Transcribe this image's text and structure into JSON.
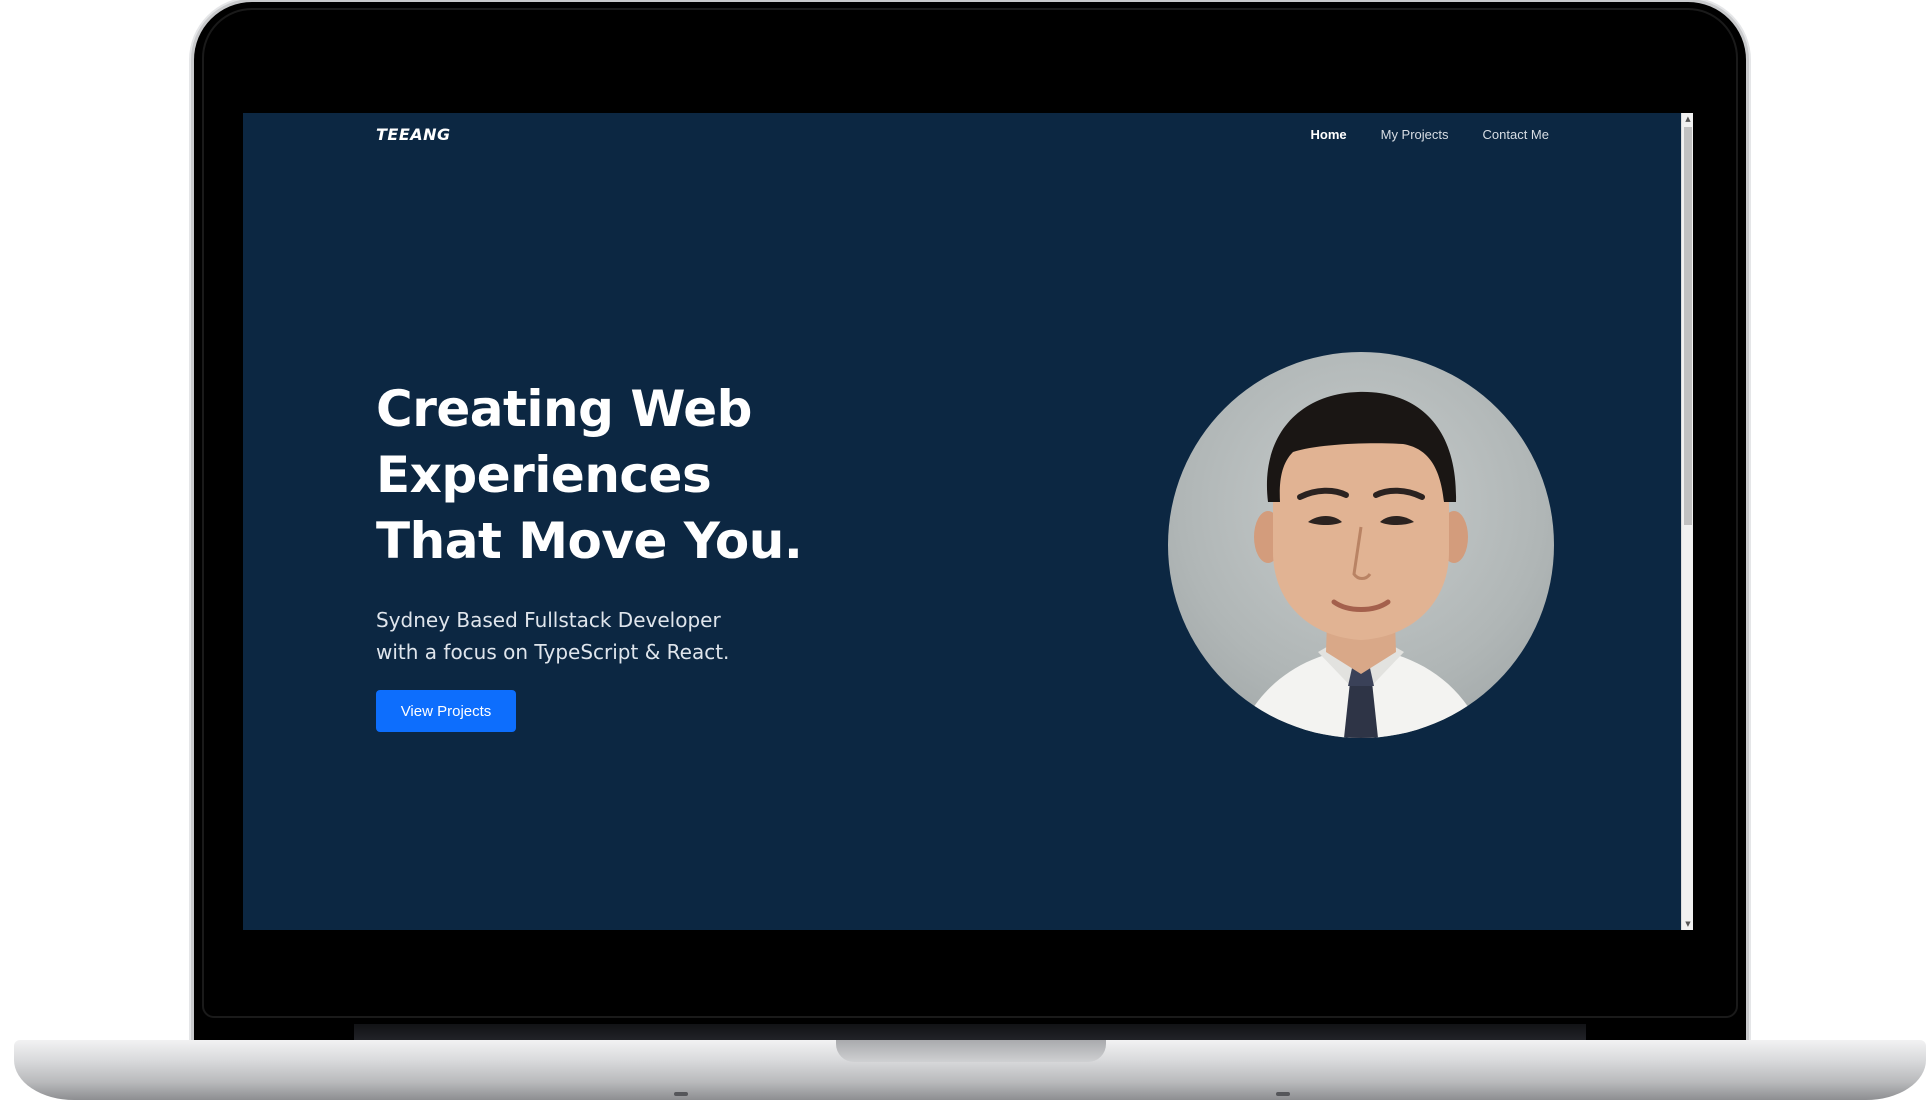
{
  "site": {
    "brand": "TEEANG"
  },
  "nav": {
    "items": [
      {
        "label": "Home",
        "active": true
      },
      {
        "label": "My Projects",
        "active": false
      },
      {
        "label": "Contact Me",
        "active": false
      }
    ]
  },
  "hero": {
    "title_lines": [
      "Creating Web",
      "Experiences",
      "That Move You."
    ],
    "subtitle_lines": [
      "Sydney Based Fullstack Developer",
      "with a focus on TypeScript & React."
    ],
    "cta_label": "View Projects"
  },
  "scrollbar": {
    "up_icon": "▲",
    "down_icon": "▼",
    "scroll_position": 0.0
  },
  "colors": {
    "background": "#0c2742",
    "accent": "#0d6efd",
    "text": "#ffffff"
  },
  "icons": {
    "scroll_up": "arrow-up-icon",
    "scroll_down": "arrow-down-icon"
  }
}
